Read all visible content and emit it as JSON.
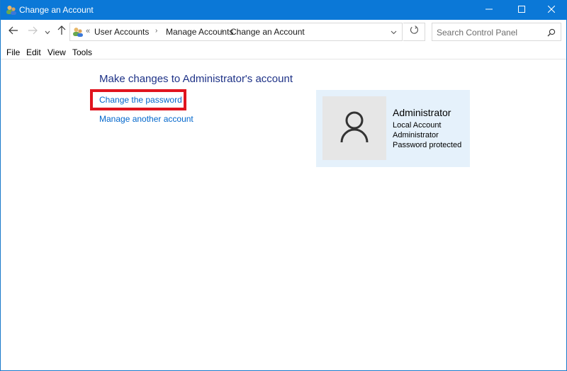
{
  "window": {
    "title": "Change an Account",
    "app_icon": "user-accounts-icon",
    "controls": {
      "minimize": "minimize-icon",
      "maximize": "maximize-icon",
      "close": "close-icon"
    }
  },
  "navigation": {
    "back": "back-arrow-icon",
    "forward": "forward-arrow-icon",
    "recent": "chevron-down-icon",
    "up": "up-arrow-icon",
    "address": {
      "overflow": "«",
      "breadcrumbs": [
        "User Accounts",
        "Manage Accounts",
        "Change an Account"
      ],
      "separator": "›"
    },
    "refresh": "refresh-icon",
    "search": {
      "placeholder": "Search Control Panel",
      "value": ""
    }
  },
  "menubar": {
    "items": [
      "File",
      "Edit",
      "View",
      "Tools"
    ]
  },
  "main": {
    "heading": "Make changes to Administrator's account",
    "links": {
      "change_password": "Change the password",
      "manage_another": "Manage another account"
    },
    "highlight_color": "#e0141e"
  },
  "account": {
    "name": "Administrator",
    "type": "Local Account",
    "role": "Administrator",
    "password_status": "Password protected",
    "card_color": "#e5f1fb"
  },
  "colors": {
    "titlebar": "#0b78d7",
    "heading": "#1e3287",
    "link": "#0066cc"
  }
}
